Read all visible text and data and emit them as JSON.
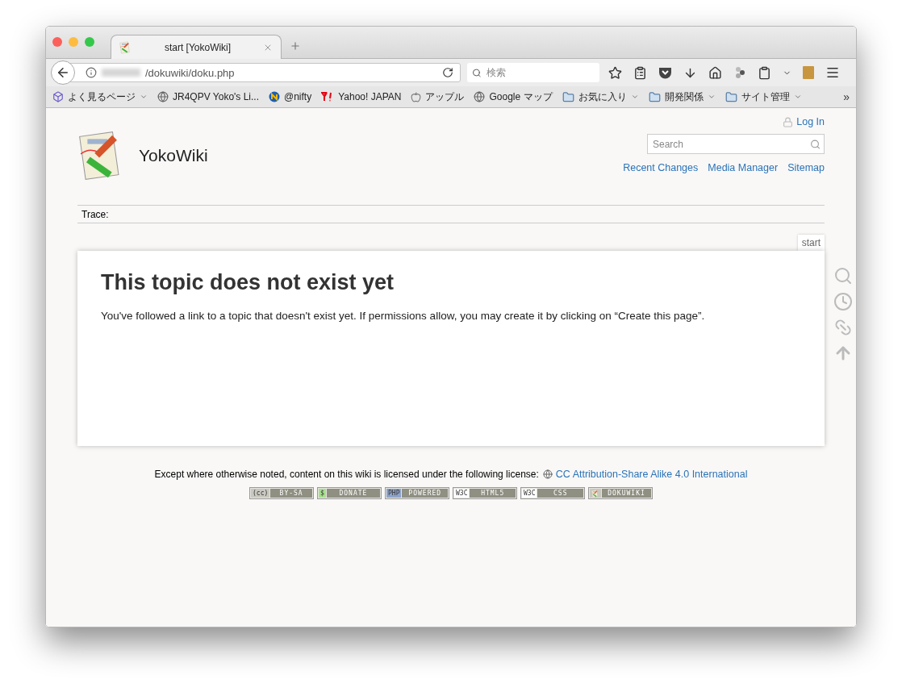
{
  "browser": {
    "tabs": [
      {
        "title": "start [YokoWiki]",
        "selected": true
      }
    ],
    "url": {
      "value": "/dokuwiki/doku.php"
    },
    "search": {
      "placeholder": "検索"
    },
    "bookmarks": [
      {
        "label": "よく見るページ",
        "kind": "smart",
        "dropdown": true
      },
      {
        "label": "JR4QPV Yoko's Li...",
        "kind": "globe",
        "dropdown": false
      },
      {
        "label": "@nifty",
        "kind": "nifty",
        "dropdown": false
      },
      {
        "label": "Yahoo! JAPAN",
        "kind": "yahoo",
        "dropdown": false
      },
      {
        "label": "アップル",
        "kind": "apple",
        "dropdown": false
      },
      {
        "label": "Google マップ",
        "kind": "globe",
        "dropdown": false
      },
      {
        "label": "お気に入り",
        "kind": "folder",
        "dropdown": true
      },
      {
        "label": "開発関係",
        "kind": "folder",
        "dropdown": true
      },
      {
        "label": "サイト管理",
        "kind": "folder",
        "dropdown": true
      }
    ],
    "bookmarks_overflow": "»"
  },
  "wiki": {
    "title": "YokoWiki",
    "login": "Log In",
    "search": {
      "placeholder": "Search"
    },
    "nav": [
      "Recent Changes",
      "Media Manager",
      "Sitemap"
    ],
    "trace": "Trace:",
    "page_id": "start",
    "heading": "This topic does not exist yet",
    "paragraph": "You've followed a link to a topic that doesn't exist yet. If permissions allow, you may create it by clicking on “Create this page”.",
    "license_text": "Except where otherwise noted, content on this wiki is licensed under the following license:",
    "license_link": "CC Attribution-Share Alike 4.0 International",
    "badges": [
      {
        "kind": "text",
        "mark": "(cc)",
        "label": "BY-SA",
        "color": "#c8c8c0"
      },
      {
        "kind": "text",
        "mark": "$",
        "label": "DONATE",
        "color": "#a6e08e"
      },
      {
        "kind": "text",
        "mark": "PHP",
        "label": "POWERED",
        "color": "#8ea3c9"
      },
      {
        "kind": "text",
        "mark": "W3C",
        "label": "HTML5",
        "color": "#ffffff"
      },
      {
        "kind": "text",
        "mark": "W3C",
        "label": "CSS",
        "color": "#ffffff"
      },
      {
        "kind": "logo",
        "label": "DOKUWIKI",
        "color": "#c8c8c0"
      }
    ]
  }
}
